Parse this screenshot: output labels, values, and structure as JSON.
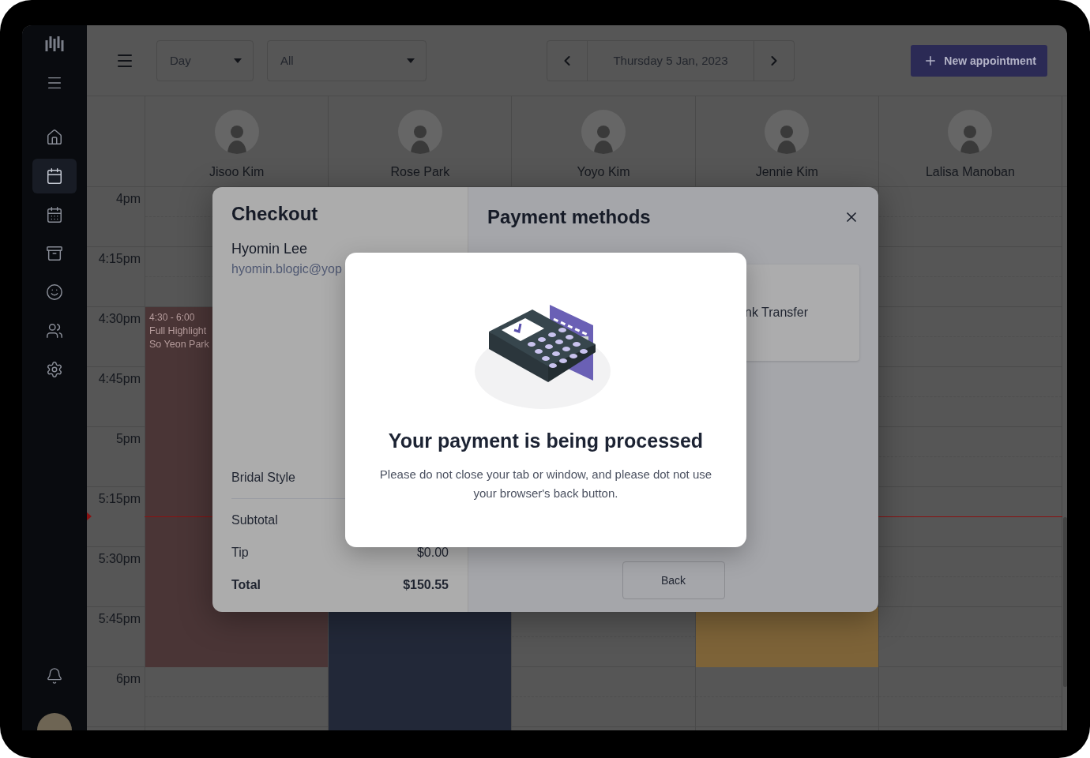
{
  "sidebar": {
    "items": [
      {
        "kind": "home",
        "selected": false
      },
      {
        "kind": "calendar",
        "selected": true
      },
      {
        "kind": "schedule",
        "selected": false
      },
      {
        "kind": "archive",
        "selected": false
      },
      {
        "kind": "smile",
        "selected": false
      },
      {
        "kind": "users",
        "selected": false
      },
      {
        "kind": "settings",
        "selected": false
      }
    ]
  },
  "toolbar": {
    "view_select": {
      "value": "Day"
    },
    "filter_select": {
      "value": "All"
    },
    "date": "Thursday 5 Jan, 2023",
    "new_button": "New appointment"
  },
  "staff": [
    {
      "name": "Jisoo Kim",
      "appointment": {
        "time": "4:30 - 6:00",
        "service": "Full Highlight",
        "client": "So Yeon Park",
        "color": "#4a3536"
      }
    },
    {
      "name": "Rose Park",
      "appointment": {
        "color": "#222838"
      }
    },
    {
      "name": "Yoyo Kim"
    },
    {
      "name": "Jennie Kim",
      "appointment": {
        "color": "#7d6338"
      }
    },
    {
      "name": "Lalisa Manoban"
    }
  ],
  "time_slots": [
    "4pm",
    "4:15pm",
    "4:30pm",
    "4:45pm",
    "5pm",
    "5:15pm",
    "5:30pm",
    "5:45pm",
    "6pm"
  ],
  "checkout": {
    "title": "Checkout",
    "client_name": "Hyomin Lee",
    "client_email": "hyomin.blogic@yop",
    "items": [
      {
        "label": "Bridal Style"
      }
    ],
    "summary": [
      {
        "kind": "line",
        "label": "Subtotal"
      },
      {
        "kind": "line",
        "label": "Tip",
        "value": "$0.00"
      },
      {
        "kind": "total",
        "label": "Total",
        "value": "$150.55"
      }
    ]
  },
  "payment": {
    "title": "Payment methods",
    "methods": [
      {
        "label": "nk Transfer"
      }
    ],
    "back_button": "Back"
  },
  "processing": {
    "title": "Your payment is being processed",
    "message": "Please do not close your tab or window, and please dot not use your browser's back button."
  }
}
